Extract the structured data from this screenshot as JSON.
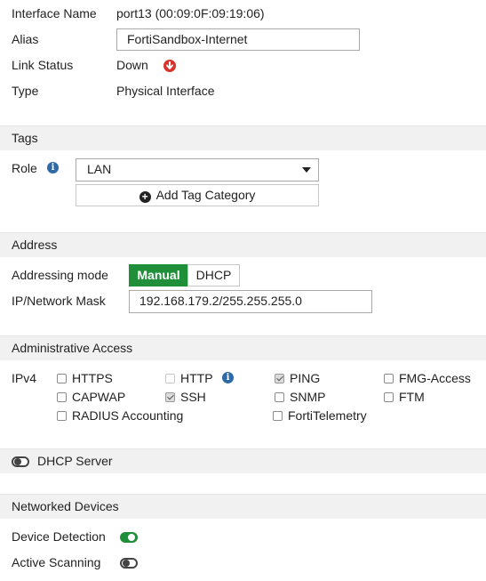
{
  "interface": {
    "name_label": "Interface Name",
    "name_value": "port13 (00:09:0F:09:19:06)",
    "alias_label": "Alias",
    "alias_value": "FortiSandbox-Internet",
    "link_status_label": "Link Status",
    "link_status_value": "Down",
    "link_status_icon": "arrow-down-circle-icon",
    "link_status_color": "#d9342b",
    "type_label": "Type",
    "type_value": "Physical Interface"
  },
  "tags": {
    "header": "Tags",
    "role_label": "Role",
    "role_value": "LAN",
    "add_tag_label": "Add Tag Category"
  },
  "address": {
    "header": "Address",
    "mode_label": "Addressing mode",
    "mode_options": [
      "Manual",
      "DHCP"
    ],
    "mode_selected": "Manual",
    "ip_label": "IP/Network Mask",
    "ip_value": "192.168.179.2/255.255.255.0"
  },
  "admin": {
    "header": "Administrative Access",
    "ipv4_label": "IPv4",
    "options": {
      "https": {
        "label": "HTTPS",
        "checked": false
      },
      "http": {
        "label": "HTTP",
        "checked": false
      },
      "ping": {
        "label": "PING",
        "checked": true
      },
      "fmg": {
        "label": "FMG-Access",
        "checked": false
      },
      "capwap": {
        "label": "CAPWAP",
        "checked": false
      },
      "ssh": {
        "label": "SSH",
        "checked": true
      },
      "snmp": {
        "label": "SNMP",
        "checked": false
      },
      "ftm": {
        "label": "FTM",
        "checked": false
      },
      "radius": {
        "label": "RADIUS Accounting",
        "checked": false
      },
      "fortitelemetry": {
        "label": "FortiTelemetry",
        "checked": false
      }
    }
  },
  "dhcp_server": {
    "label": "DHCP Server",
    "enabled": false
  },
  "networked_devices": {
    "header": "Networked Devices",
    "device_detection_label": "Device Detection",
    "device_detection_enabled": true,
    "active_scanning_label": "Active Scanning",
    "active_scanning_enabled": false
  },
  "colors": {
    "accent_green": "#1f8f3a",
    "info_blue": "#2f6aa8",
    "section_bg": "#f1f1f1"
  }
}
